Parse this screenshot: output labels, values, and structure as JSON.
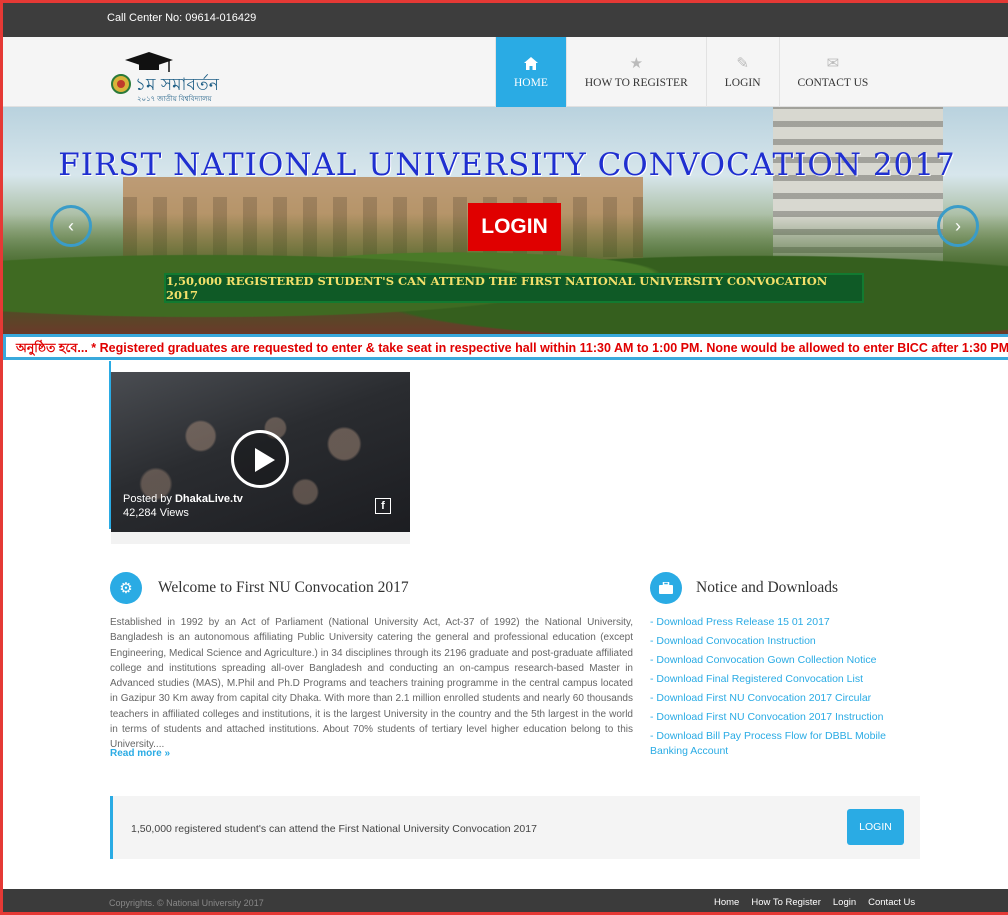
{
  "topbar": {
    "call_center": "Call Center No: 09614-016429"
  },
  "logo": {
    "text": "১ম সমাবর্তন",
    "sub": "২০১৭ জাতীয় বিশ্ববিদ্যালয়"
  },
  "nav": {
    "items": [
      {
        "label": "HOME",
        "icon": "home-icon",
        "active": true
      },
      {
        "label": "HOW TO REGISTER",
        "icon": "star-icon",
        "active": false
      },
      {
        "label": "LOGIN",
        "icon": "pencil-icon",
        "active": false
      },
      {
        "label": "CONTACT US",
        "icon": "envelope-icon",
        "active": false
      }
    ]
  },
  "hero": {
    "title": "FIRST NATIONAL UNIVERSITY CONVOCATION 2017",
    "login_label": "LOGIN",
    "banner": "1,50,000 REGISTERED STUDENT'S CAN ATTEND THE FIRST NATIONAL UNIVERSITY CONVOCATION 2017",
    "prev_arrow": "‹",
    "next_arrow": "›"
  },
  "marquee": {
    "text": "অনুষ্ঠিত হবে... * Registered graduates are requested to enter & take seat in respective hall within 11:30 AM to 1:00 PM. None would be allowed to enter BICC after 1:30 PM"
  },
  "video": {
    "posted_prefix": "Posted by",
    "posted_by": "DhakaLive.tv",
    "views": "42,284 Views",
    "fb_icon": "facebook-icon"
  },
  "welcome": {
    "title": "Welcome to First NU Convocation 2017",
    "icon": "gear-icon",
    "body": "Established in 1992 by an Act of Parliament (National University Act, Act-37 of 1992) the National University, Bangladesh is an autonomous affiliating Public University catering the general and professional education (except Engineering, Medical Science and Agriculture.) in 34 disciplines through its 2196 graduate and post-graduate affiliated college and institutions spreading all-over Bangladesh and conducting an on-campus research-based Master in Advanced studies (MAS), M.Phil and Ph.D Programs and teachers training programme in the central campus located in Gazipur 30 Km away from capital city Dhaka. With more than 2.1 million enrolled students and nearly 60 thousands teachers in affiliated colleges and institutions, it is the largest University in the country and the 5th largest in the world in terms of students and attached institutions. About 70% students of tertiary level higher education belong to this University....",
    "read_more": "Read more »"
  },
  "notices": {
    "title": "Notice and Downloads",
    "icon": "briefcase-icon",
    "items": [
      "- Download Press Release 15 01 2017",
      "- Download Convocation Instruction",
      "- Download Convocation Gown Collection Notice",
      "- Download Final Registered Convocation List",
      "- Download First NU Convocation 2017 Circular",
      "- Download First NU Convocation 2017 Instruction",
      "- Download Bill Pay Process Flow for DBBL Mobile Banking Account"
    ]
  },
  "cta": {
    "text": "1,50,000 registered student's can attend the First National University Convocation 2017",
    "button": "LOGIN"
  },
  "footer": {
    "copyright": "Copyrights. © National University 2017",
    "links": [
      "Home",
      "How To Register",
      "Login",
      "Contact Us"
    ]
  },
  "colors": {
    "accent": "#2aabe4",
    "alert": "#e00000",
    "banner_green": "#0f5a26",
    "hero_title": "#1f2fd0"
  }
}
